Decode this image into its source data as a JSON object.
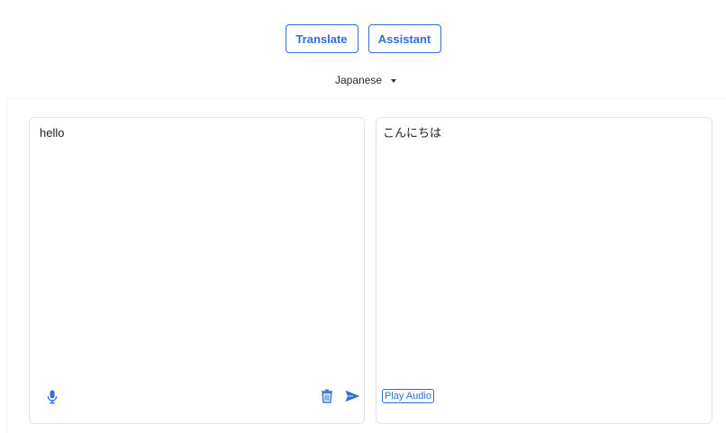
{
  "modes": {
    "translate_label": "Translate",
    "assistant_label": "Assistant"
  },
  "language": {
    "selected": "Japanese"
  },
  "input": {
    "text": "hello"
  },
  "output": {
    "text": "こんにちは",
    "play_audio_label": "Play Audio"
  },
  "icons": {
    "mic": "microphone-icon",
    "trash": "trash-icon",
    "send": "send-icon"
  },
  "colors": {
    "accent": "#2f6fd8",
    "panel_border": "#e3e3e3",
    "text": "#1f1f1f"
  }
}
